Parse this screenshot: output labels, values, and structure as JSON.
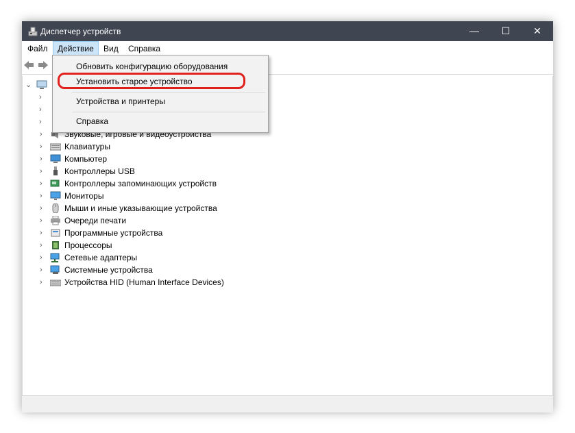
{
  "window": {
    "title": "Диспетчер устройств",
    "minimize": "—",
    "maximize": "☐",
    "close": "✕"
  },
  "menu": {
    "file": "Файл",
    "action": "Действие",
    "view": "Вид",
    "help": "Справка"
  },
  "dropdown": {
    "update": "Обновить конфигурацию оборудования",
    "legacy": "Установить старое устройство",
    "printers": "Устройства и принтеры",
    "help": "Справка"
  },
  "tree": {
    "items": [
      {
        "label": "Звуковые, игровые и видеоустройства",
        "icon": "speaker-icon"
      },
      {
        "label": "Клавиатуры",
        "icon": "keyboard-icon"
      },
      {
        "label": "Компьютер",
        "icon": "computer-icon"
      },
      {
        "label": "Контроллеры USB",
        "icon": "usb-icon"
      },
      {
        "label": "Контроллеры запоминающих устройств",
        "icon": "storage-controller-icon"
      },
      {
        "label": "Мониторы",
        "icon": "monitor-icon"
      },
      {
        "label": "Мыши и иные указывающие устройства",
        "icon": "mouse-icon"
      },
      {
        "label": "Очереди печати",
        "icon": "printer-icon"
      },
      {
        "label": "Программные устройства",
        "icon": "software-device-icon"
      },
      {
        "label": "Процессоры",
        "icon": "cpu-icon"
      },
      {
        "label": "Сетевые адаптеры",
        "icon": "network-adapter-icon"
      },
      {
        "label": "Системные устройства",
        "icon": "system-device-icon"
      },
      {
        "label": "Устройства HID (Human Interface Devices)",
        "icon": "hid-icon"
      }
    ]
  },
  "colors": {
    "titlebar": "#3f4652",
    "highlight": "#e0201c",
    "menu_active": "#cce4f7"
  }
}
